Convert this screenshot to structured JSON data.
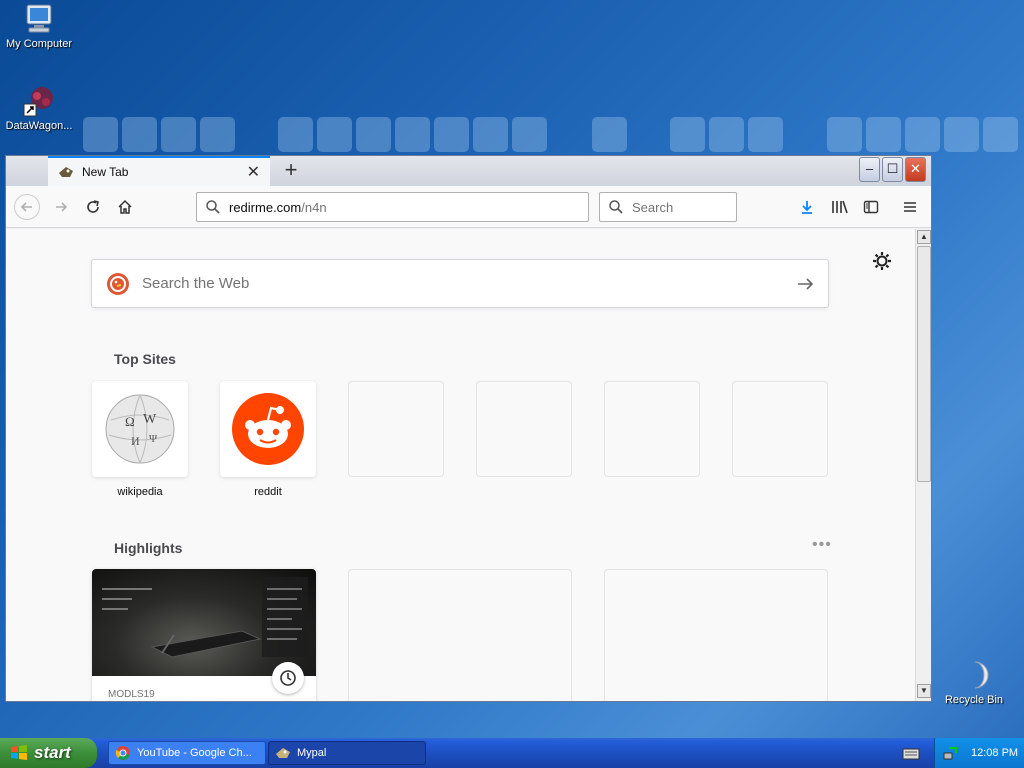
{
  "desktop": {
    "icons": [
      {
        "label": "My Computer"
      },
      {
        "label": "DataWagon..."
      },
      {
        "label": "Recycle Bin"
      }
    ]
  },
  "browser": {
    "tab_title": "New Tab",
    "url_domain": "redirme.com",
    "url_path": "/n4n",
    "search_placeholder": "Search",
    "websearch_placeholder": "Search the Web",
    "top_sites_title": "Top Sites",
    "top_sites": [
      {
        "label": "wikipedia",
        "icon": "wikipedia-globe-icon"
      },
      {
        "label": "reddit",
        "icon": "reddit-alien-icon"
      },
      {
        "label": ""
      },
      {
        "label": ""
      },
      {
        "label": ""
      },
      {
        "label": ""
      }
    ],
    "highlights_title": "Highlights",
    "highlights": [
      {
        "source": "MODLS19",
        "icon": "clock-icon"
      },
      {
        "source": ""
      },
      {
        "source": ""
      }
    ],
    "colors": {
      "accent": "#0a84ff",
      "reddit": "#ff4500"
    }
  },
  "taskbar": {
    "start_label": "start",
    "buttons": [
      {
        "label": "YouTube - Google Ch..."
      },
      {
        "label": "Mypal"
      }
    ],
    "clock": "12:08 PM"
  }
}
